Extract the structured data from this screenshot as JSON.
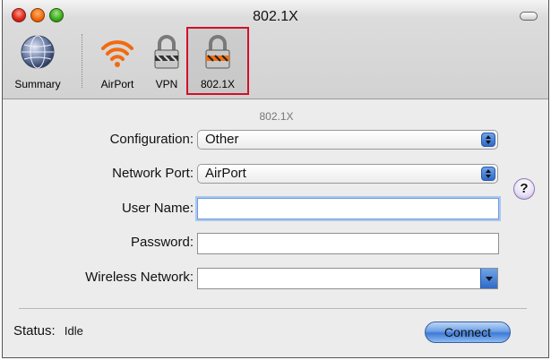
{
  "window": {
    "title": "802.1X"
  },
  "toolbar": {
    "items": [
      {
        "label": "Summary",
        "icon": "globe-icon"
      },
      {
        "label": "AirPort",
        "icon": "airport-wifi-icon"
      },
      {
        "label": "VPN",
        "icon": "lock-icon"
      },
      {
        "label": "802.1X",
        "icon": "lock-icon",
        "selected": true
      }
    ]
  },
  "form": {
    "section_label": "802.1X",
    "configuration": {
      "label": "Configuration:",
      "value": "Other"
    },
    "network_port": {
      "label": "Network Port:",
      "value": "AirPort"
    },
    "user_name": {
      "label": "User Name:",
      "value": ""
    },
    "password": {
      "label": "Password:",
      "value": ""
    },
    "wireless_network": {
      "label": "Wireless Network:",
      "value": ""
    }
  },
  "footer": {
    "status_label": "Status:",
    "status_value": "Idle",
    "connect_label": "Connect"
  },
  "colors": {
    "selection_highlight": "#d0102a",
    "accent_blue": "#3e7ad6"
  }
}
